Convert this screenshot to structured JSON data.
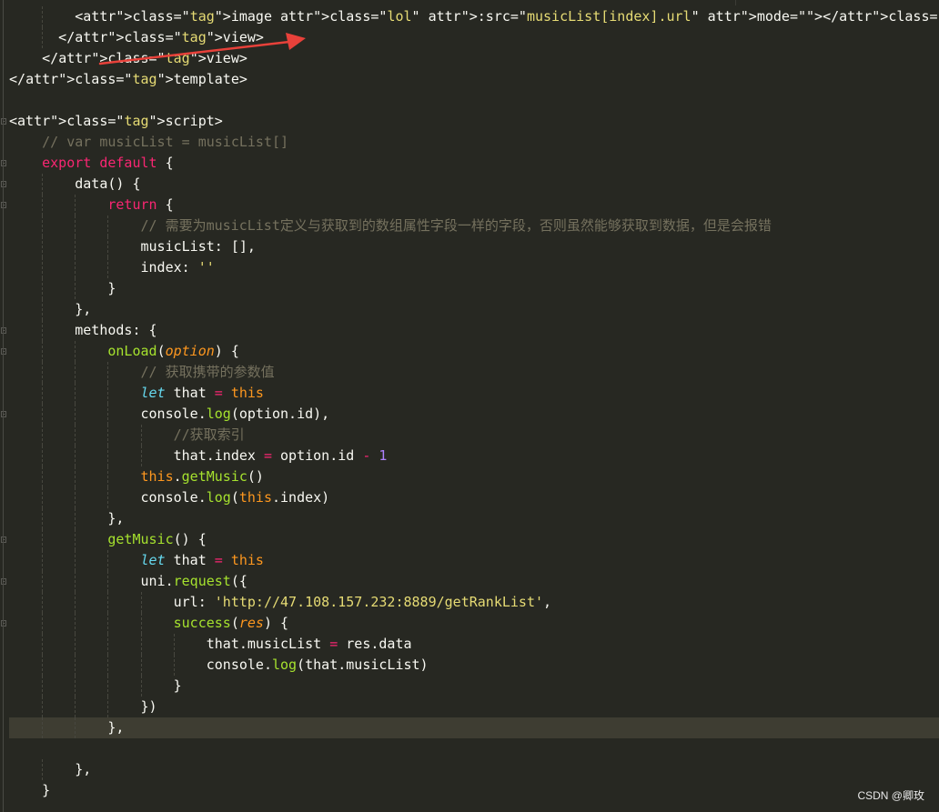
{
  "editor": {
    "theme": "monokai",
    "colors": {
      "background": "#272822",
      "tag": "#f92672",
      "attribute": "#a6e22e",
      "string": "#e6db74",
      "comment": "#75715e",
      "number": "#ae81ff",
      "storage": "#66d9ef",
      "parameter": "#fd971f",
      "annotation_arrow": "#e8413a"
    },
    "lines": [
      "        <image class=\"lol\" :src=\"musicList[index].url\" mode=\"\"></image>",
      "      </view>",
      "    </view>",
      "</template>",
      "",
      "<script>",
      "    // var musicList = musicList[]",
      "    export default {",
      "        data() {",
      "            return {",
      "                // 需要为musicList定义与获取到的数组属性字段一样的字段，否则虽然能够获取到数据，但是会报错",
      "                musicList: [],",
      "                index: ''",
      "            }",
      "        },",
      "        methods: {",
      "            onLoad(option) {",
      "                // 获取携带的参数值",
      "                let that = this",
      "                console.log(option.id),",
      "                    //获取索引",
      "                    that.index = option.id - 1",
      "                this.getMusic()",
      "                console.log(this.index)",
      "            },",
      "            getMusic() {",
      "                let that = this",
      "                uni.request({",
      "                    url: 'http://47.108.157.232:8889/getRankList',",
      "                    success(res) {",
      "                        that.musicList = res.data",
      "                        console.log(that.musicList)",
      "                    }",
      "                })",
      "            },",
      "",
      "        },",
      "    }"
    ],
    "current_line": 34
  },
  "watermark": "CSDN @卿玫"
}
